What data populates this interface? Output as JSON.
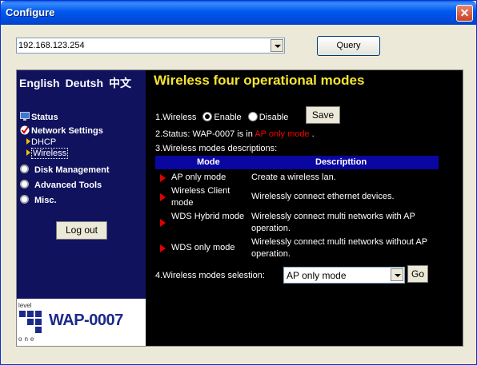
{
  "window": {
    "title": "Configure"
  },
  "address": {
    "value": "192.168.123.254"
  },
  "query_button": "Query",
  "languages": [
    "English",
    "Deutsh",
    "中文"
  ],
  "nav": {
    "status": "Status",
    "network_settings": "Network Settings",
    "dhcp": "DHCP",
    "wireless": "Wireless",
    "disk_management": "Disk Management",
    "advanced_tools": "Advanced Tools",
    "misc": "Misc."
  },
  "logout_button": "Log out",
  "logo": {
    "brand": "level one",
    "model": "WAP-0007"
  },
  "main": {
    "heading": "Wireless four operational modes",
    "wireless_label": "1.Wireless",
    "enable_label": "Enable",
    "disable_label": "Disable",
    "wireless_enabled": true,
    "save_button": "Save",
    "status_prefix": "2.Status: WAP-0007 is in ",
    "status_mode": "AP only mode",
    "status_suffix": " .",
    "descriptions_label": "3.Wireless modes descriptions:",
    "table": {
      "headers": [
        "Mode",
        "Descripttion"
      ],
      "rows": [
        {
          "mode": "AP only mode",
          "description": "Create a wireless lan."
        },
        {
          "mode": "Wireless Client mode",
          "description": "Wirelessly connect ethernet devices."
        },
        {
          "mode": "WDS Hybrid mode",
          "description": "Wirelessly connect multi networks with AP operation."
        },
        {
          "mode": "WDS only mode",
          "description": "Wirelessly connect multi networks without AP operation."
        }
      ]
    },
    "selection_label": "4.Wireless modes selestion:",
    "selected_mode": "AP only mode",
    "go_button": "Go"
  },
  "colors": {
    "heading": "#f5e533",
    "status_mode": "#f20000",
    "table_header": "#0a06a0",
    "sidebar": "#10125e"
  }
}
